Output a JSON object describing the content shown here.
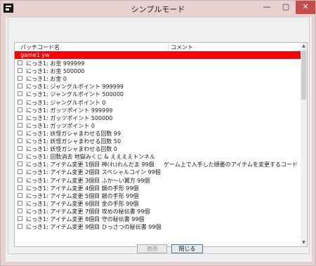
{
  "window": {
    "title": "シンプルモード",
    "controls": {
      "minimize": "—",
      "maximize": "▢",
      "close": "✕"
    }
  },
  "list": {
    "columns": [
      "パッチコード名",
      "コメント"
    ],
    "rows": [
      {
        "name": "game1 yw",
        "comment": "",
        "selected": true,
        "checkbox": false
      },
      {
        "name": "にっき1: お金 999999",
        "comment": "",
        "selected": false,
        "checkbox": true
      },
      {
        "name": "にっき1: お金 500000",
        "comment": "",
        "selected": false,
        "checkbox": true
      },
      {
        "name": "にっき1: お金 0",
        "comment": "",
        "selected": false,
        "checkbox": true
      },
      {
        "name": "にっき1: ジャングルポイント 999999",
        "comment": "",
        "selected": false,
        "checkbox": true
      },
      {
        "name": "にっき1: ジャングルポイント 500000",
        "comment": "",
        "selected": false,
        "checkbox": true
      },
      {
        "name": "にっき1: ジャングルポイント 0",
        "comment": "",
        "selected": false,
        "checkbox": true
      },
      {
        "name": "にっき1: ガッツポイント 999999",
        "comment": "",
        "selected": false,
        "checkbox": true
      },
      {
        "name": "にっき1: ガッツポイント 500000",
        "comment": "",
        "selected": false,
        "checkbox": true
      },
      {
        "name": "にっき1: ガッツポイント 0",
        "comment": "",
        "selected": false,
        "checkbox": true
      },
      {
        "name": "にっき1: 妖怪ガシャまわせる回数 99",
        "comment": "",
        "selected": false,
        "checkbox": true
      },
      {
        "name": "にっき1: 妖怪ガシャまわせる回数 50",
        "comment": "",
        "selected": false,
        "checkbox": true
      },
      {
        "name": "にっき1: 妖怪ガシャまわせる回数 0",
        "comment": "",
        "selected": false,
        "checkbox": true
      },
      {
        "name": "にっき1: 回数消去 地獄みくじ & ええええトンネル",
        "comment": "",
        "selected": false,
        "checkbox": true
      },
      {
        "name": "にっき1: アイテム変更 1個目 神(れ)れんだま 99個",
        "comment": "ゲーム上で入手した順番のアイテムを変更するコードになりますので…",
        "selected": false,
        "checkbox": true
      },
      {
        "name": "にっき1: アイテム変更 2個目 スペシャルコイン 99個",
        "comment": "",
        "selected": false,
        "checkbox": true
      },
      {
        "name": "にっき1: アイテム変更 3個目 ふか〜い翼方 99個",
        "comment": "",
        "selected": false,
        "checkbox": true
      },
      {
        "name": "にっき1: アイテム変更 4個目 鋼の手形 99個",
        "comment": "",
        "selected": false,
        "checkbox": true
      },
      {
        "name": "にっき1: アイテム変更 5個目 銀の手形 99個",
        "comment": "",
        "selected": false,
        "checkbox": true
      },
      {
        "name": "にっき1: アイテム変更 6個目 金の手形 99個",
        "comment": "",
        "selected": false,
        "checkbox": true
      },
      {
        "name": "にっき1: アイテム変更 7個目 攻めの秘伝書 99個",
        "comment": "",
        "selected": false,
        "checkbox": true
      },
      {
        "name": "にっき1: アイテム変更 8個目 守の秘伝書 99個",
        "comment": "",
        "selected": false,
        "checkbox": true
      },
      {
        "name": "にっき1: アイテム変更 9個目 ひっさつの秘伝書 99個",
        "comment": "",
        "selected": false,
        "checkbox": true
      }
    ]
  },
  "buttons": {
    "apply": "適用",
    "close": "閉じる"
  },
  "scroll": {
    "up": "▲",
    "down": "▼"
  },
  "colors": {
    "selection": "#ff0000",
    "titlebar": "#e7d0d0",
    "close_button": "#c74b4b"
  }
}
